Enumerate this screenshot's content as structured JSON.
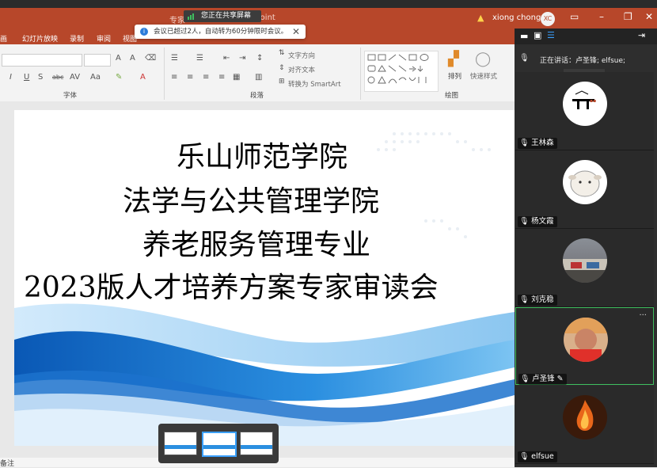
{
  "window": {
    "title_fragment_left": "专家",
    "title_fragment_right": "Point",
    "user_name": "xiong chong",
    "user_initials": "XC",
    "sharing_badge": "您正在共享屏幕"
  },
  "tabs": [
    "画",
    "幻灯片放映",
    "录制",
    "审阅",
    "视图"
  ],
  "notice": {
    "text": "会议已超过2人，自动转为60分钟限时会议。",
    "close": "✕"
  },
  "ribbon": {
    "groups": [
      "字体",
      "段落",
      "绘图"
    ],
    "font_buttons": [
      "I",
      "U",
      "S",
      "abc",
      "AV",
      "Aa",
      "A"
    ],
    "paragraph_items": [
      "文字方向",
      "对齐文本",
      "转换为 SmartArt"
    ],
    "arrange_label": "排列",
    "quick_styles_label": "快速样式"
  },
  "slide": {
    "lines": [
      "乐山师范学院",
      "法学与公共管理学院",
      "养老服务管理专业",
      "2023版人才培养方案专家审读会"
    ],
    "notes_label": "备注"
  },
  "panel": {
    "speaking_label": "正在讲话：卢圣锋; elfsue;",
    "participants": [
      {
        "name": "王林森",
        "muted": true
      },
      {
        "name": "杨文霞",
        "muted": true
      },
      {
        "name": "刘克稳",
        "muted": true
      },
      {
        "name": "卢圣锋",
        "muted": false,
        "active": true
      },
      {
        "name": "elfsue",
        "muted": false
      }
    ],
    "more_label": "···"
  },
  "colors": {
    "accent": "#b7472a",
    "panel_bg": "#2e2e2e",
    "active_border": "#3fbf5f"
  }
}
